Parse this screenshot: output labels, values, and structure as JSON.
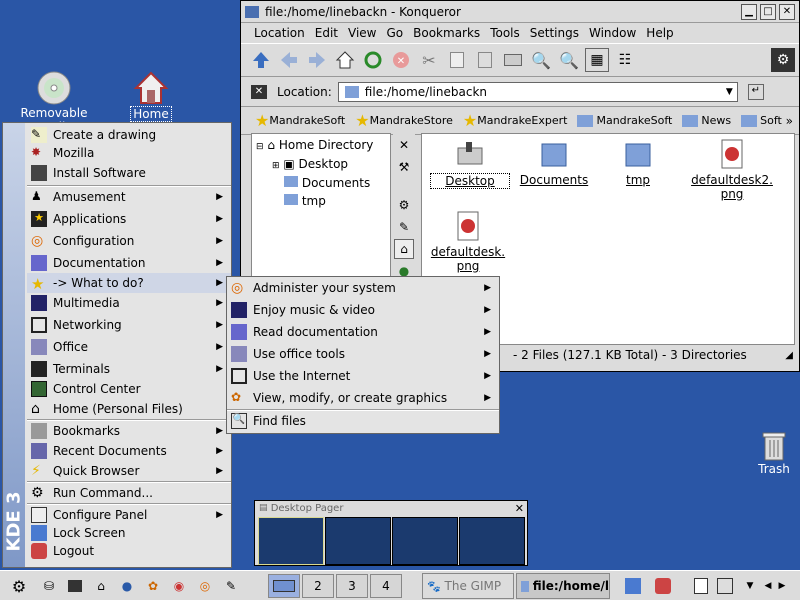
{
  "desktop": {
    "icons": [
      {
        "label": "Removable media",
        "icon": "cd-icon"
      },
      {
        "label": "Home",
        "icon": "home-icon"
      },
      {
        "label": "Trash",
        "icon": "trash-icon"
      }
    ]
  },
  "konqueror": {
    "title": "file:/home/linebackn - Konqueror",
    "menu": [
      "Location",
      "Edit",
      "View",
      "Go",
      "Bookmarks",
      "Tools",
      "Settings",
      "Window",
      "Help"
    ],
    "location_label": "Location:",
    "location_value": "file:/home/linebackn",
    "bookmarks": [
      "MandrakeSoft",
      "MandrakeStore",
      "MandrakeExpert",
      "MandrakeSoft",
      "News",
      "Soft"
    ],
    "bookmark_overflow": "»",
    "tree": {
      "root": "Home Directory",
      "children": [
        "Desktop",
        "Documents",
        "tmp"
      ]
    },
    "files": [
      {
        "name": "Desktop",
        "icon": "desktop-folder-icon"
      },
      {
        "name": "Documents",
        "icon": "folder-icon"
      },
      {
        "name": "tmp",
        "icon": "folder-icon"
      },
      {
        "name": "defaultdesk2.png",
        "line1": "defaultdesk2.",
        "line2": "png",
        "icon": "png-file-icon"
      },
      {
        "name": "defaultdesk.png",
        "line1": "defaultdesk.",
        "line2": "png",
        "icon": "png-file-icon"
      }
    ],
    "status": "- 2 Files (127.1 KB Total) - 3 Directories"
  },
  "kmenu": {
    "brand": "KDE 3",
    "items": [
      {
        "label": "Create a drawing",
        "submenu": false
      },
      {
        "label": "Mozilla",
        "submenu": false
      },
      {
        "label": "Install Software",
        "submenu": false
      },
      {
        "label": "Amusement",
        "submenu": true
      },
      {
        "label": "Applications",
        "submenu": true
      },
      {
        "label": "Configuration",
        "submenu": true
      },
      {
        "label": "Documentation",
        "submenu": true
      },
      {
        "label": "-> What to do?",
        "submenu": true
      },
      {
        "label": "Multimedia",
        "submenu": true
      },
      {
        "label": "Networking",
        "submenu": true
      },
      {
        "label": "Office",
        "submenu": true
      },
      {
        "label": "Terminals",
        "submenu": true
      },
      {
        "label": "Control Center",
        "submenu": false
      },
      {
        "label": "Home (Personal Files)",
        "submenu": false
      },
      {
        "label": "Bookmarks",
        "submenu": true
      },
      {
        "label": "Recent Documents",
        "submenu": true
      },
      {
        "label": "Quick Browser",
        "submenu": true
      },
      {
        "label": "Run Command...",
        "submenu": false
      },
      {
        "label": "Configure Panel",
        "submenu": true
      },
      {
        "label": "Lock Screen",
        "submenu": false
      },
      {
        "label": "Logout",
        "submenu": false
      }
    ]
  },
  "submenu": {
    "items": [
      {
        "label": "Administer your system",
        "submenu": true
      },
      {
        "label": "Enjoy music & video",
        "submenu": true
      },
      {
        "label": "Read documentation",
        "submenu": true
      },
      {
        "label": "Use office tools",
        "submenu": true
      },
      {
        "label": "Use the Internet",
        "submenu": true
      },
      {
        "label": "View, modify, or create graphics",
        "submenu": true
      },
      {
        "label": "Find files",
        "submenu": false
      }
    ]
  },
  "pager": {
    "title": "Desktop Pager"
  },
  "taskbar": {
    "desktops": [
      "1",
      "2",
      "3",
      "4"
    ],
    "tasks": [
      "The GIMP",
      "file:/home/l"
    ]
  },
  "colors": {
    "desktop_bg": "#2a56a6",
    "menu_bg": "#e4e4e4",
    "highlight": "#cfd6e6"
  }
}
